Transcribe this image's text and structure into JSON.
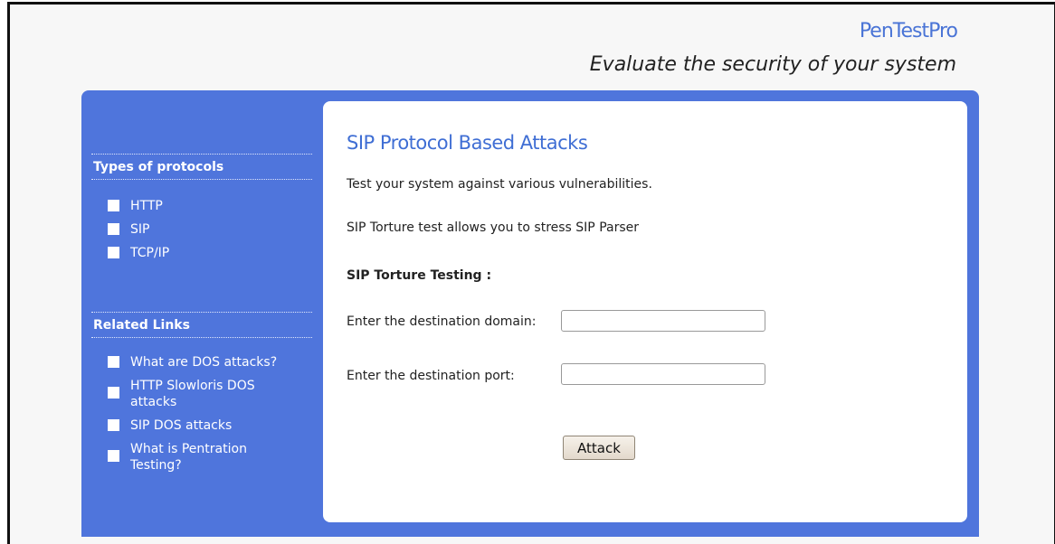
{
  "header": {
    "brand": "PenTestPro",
    "tagline": "Evaluate the security of your system"
  },
  "sidebar": {
    "protocols_title": "Types of protocols",
    "protocols": [
      {
        "label": "HTTP"
      },
      {
        "label": "SIP"
      },
      {
        "label": "TCP/IP"
      }
    ],
    "links_title": "Related Links",
    "links": [
      {
        "label": "What are DOS attacks?"
      },
      {
        "label": "HTTP Slowloris DOS attacks"
      },
      {
        "label": "SIP DOS attacks"
      },
      {
        "label": "What is Pentration Testing?"
      }
    ]
  },
  "main": {
    "title": "SIP Protocol Based Attacks",
    "intro": "Test your system against various vulnerabilities.",
    "description": "SIP Torture test allows you to stress SIP Parser",
    "section_heading": "SIP Torture Testing :",
    "domain_label": "Enter the destination domain:",
    "domain_value": "",
    "port_label": "Enter the destination port:",
    "port_value": "",
    "attack_button": "Attack"
  },
  "colors": {
    "panel_blue": "#4f75dc",
    "link_blue": "#3f6ed4",
    "brand_blue": "#4a74d6"
  },
  "icons": {
    "list_bullet": "square-bullet-icon"
  }
}
